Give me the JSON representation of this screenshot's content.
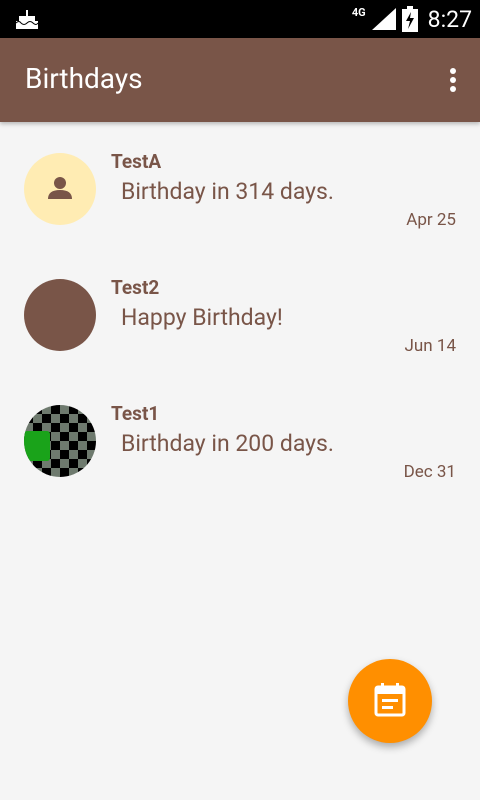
{
  "status_bar": {
    "network": "4G",
    "time": "8:27",
    "icons": [
      "cake-icon",
      "signal-icon",
      "battery-charging-icon"
    ]
  },
  "app_bar": {
    "title": "Birthdays",
    "menu_icon": "more-vert-icon"
  },
  "contacts": [
    {
      "name": "TestA",
      "message": "Birthday in 314 days.",
      "date": "Apr 25",
      "avatar": "person-icon",
      "avatar_color": "#ffecb3"
    },
    {
      "name": "Test2",
      "message": "Happy Birthday!",
      "date": "Jun 14",
      "avatar": "plain",
      "avatar_color": "#795548"
    },
    {
      "name": "Test1",
      "message": "Birthday in 200 days.",
      "date": "Dec 31",
      "avatar": "checkered-photo",
      "avatar_color": "#000000"
    }
  ],
  "fab": {
    "icon": "event-note-icon",
    "color": "#ff8f00"
  },
  "colors": {
    "primary": "#795548",
    "accent": "#ff8f00",
    "background": "#f5f5f5"
  }
}
